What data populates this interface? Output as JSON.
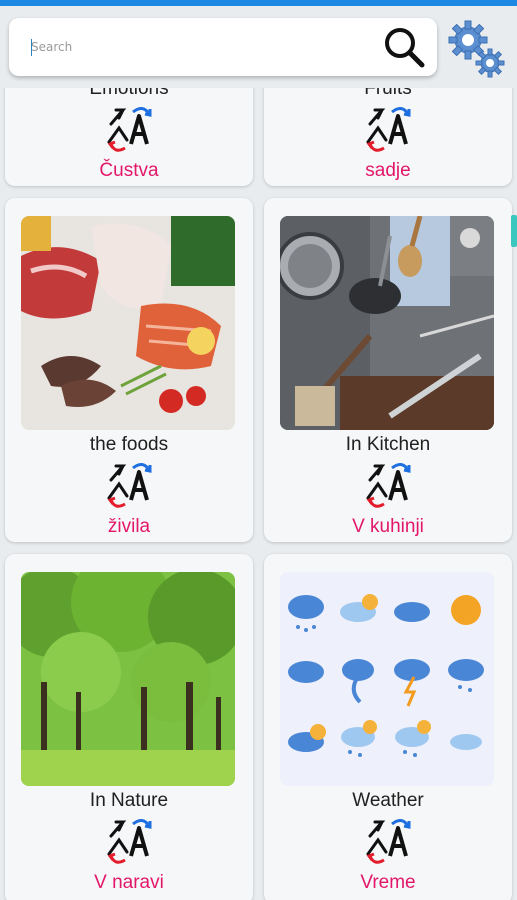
{
  "search": {
    "placeholder": "Search",
    "value": ""
  },
  "toolbar": {
    "search_icon": "search-icon",
    "settings_icon": "gear-icon"
  },
  "categories": [
    {
      "en": "Emotions",
      "sl": "Čustva",
      "image": "none"
    },
    {
      "en": "Fruits",
      "sl": "sadje",
      "image": "none"
    },
    {
      "en": "the foods",
      "sl": "živila",
      "image": "meat-and-fish-photo"
    },
    {
      "en": "In Kitchen",
      "sl": "V kuhinji",
      "image": "kitchen-utensils-photo"
    },
    {
      "en": "In Nature",
      "sl": "V naravi",
      "image": "forest-photo"
    },
    {
      "en": "Weather",
      "sl": "Vreme",
      "image": "weather-icons-grid"
    }
  ],
  "colors": {
    "accent": "#e3176a",
    "statusbar": "#1e88e5",
    "scroll": "#39c7c0"
  }
}
